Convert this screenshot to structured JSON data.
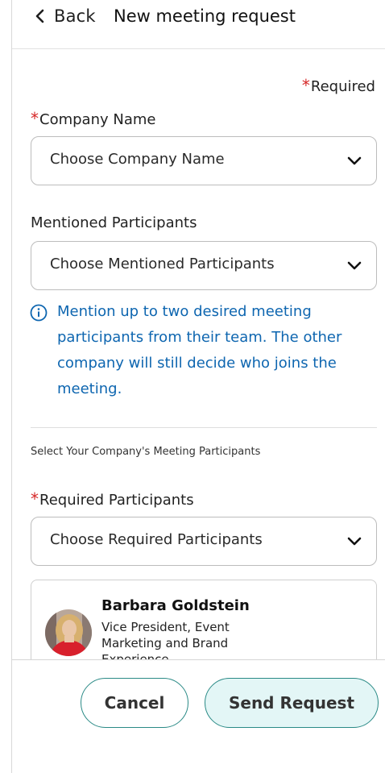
{
  "header": {
    "back_label": "Back",
    "title": "New meeting request"
  },
  "required_note": "Required",
  "company": {
    "label": "Company Name",
    "required": true,
    "placeholder": "Choose Company Name"
  },
  "mentioned": {
    "label": "Mentioned Participants",
    "placeholder": "Choose Mentioned Participants",
    "info": "Mention up to two desired meeting participants from their team. The other company will still decide who joins the meeting."
  },
  "section_title": "Select Your Company's Meeting Participants",
  "required_participants": {
    "label": "Required Participants",
    "placeholder": "Choose Required Participants"
  },
  "participant": {
    "name": "Barbara Goldstein",
    "role": "Vice President, Event Marketing and Brand Experience"
  },
  "footer": {
    "cancel_label": "Cancel",
    "send_label": "Send Request"
  },
  "colors": {
    "required_star": "#d62828",
    "info_text": "#0e66b0",
    "button_border": "#2a8a86",
    "send_bg": "#e3f6f6"
  },
  "icons": {
    "back": "chevron-left-icon",
    "dropdown": "chevron-down-icon",
    "info": "info-circle-icon"
  }
}
